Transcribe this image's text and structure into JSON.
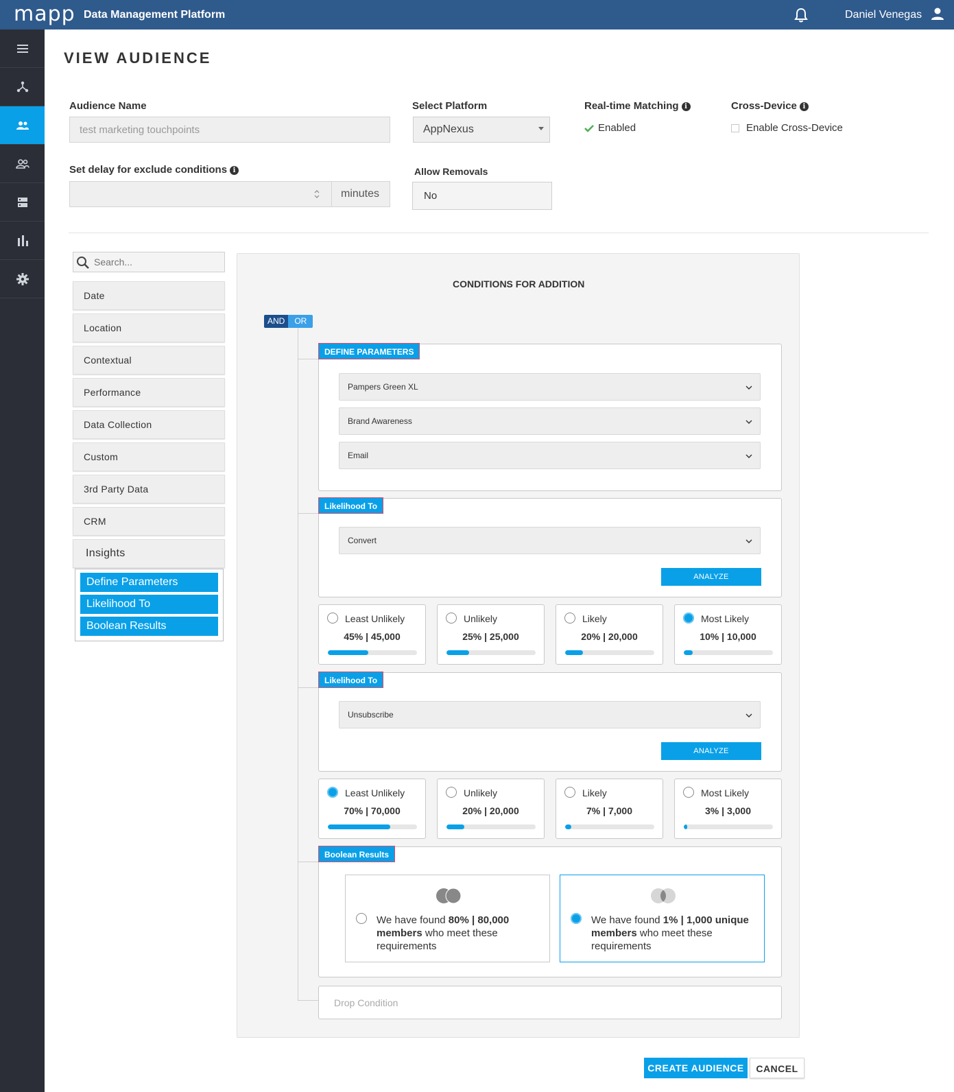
{
  "app": {
    "logo": "mapp",
    "title": "Data Management Platform",
    "user_name": "Daniel Venegas"
  },
  "colors": {
    "topbar": "#2f5a8c",
    "sidebar": "#2b2e36",
    "accent": "#0aa0e8"
  },
  "sidebar": {
    "items": [
      {
        "icon": "menu-icon"
      },
      {
        "icon": "network-icon"
      },
      {
        "icon": "audience-icon",
        "active": true
      },
      {
        "icon": "segments-icon"
      },
      {
        "icon": "data-icon"
      },
      {
        "icon": "chart-icon"
      },
      {
        "icon": "gear-icon"
      }
    ]
  },
  "page": {
    "title": "VIEW AUDIENCE"
  },
  "form": {
    "audience_name_label": "Audience Name",
    "audience_name_placeholder": "test marketing touchpoints",
    "platform_label": "Select Platform",
    "platform_value": "AppNexus",
    "realtime_label": "Real-time Matching",
    "realtime_value": "Enabled",
    "crossdevice_label": "Cross-Device",
    "crossdevice_value": "Enable Cross-Device",
    "delay_label": "Set delay for exclude conditions",
    "delay_unit": "minutes",
    "removals_label": "Allow Removals",
    "removals_value": "No"
  },
  "criteria": {
    "search_placeholder": "Search...",
    "categories": [
      "Date",
      "Location",
      "Contextual",
      "Performance",
      "Data Collection",
      "Custom",
      "3rd Party Data",
      "CRM",
      "Insights"
    ],
    "insights_items": [
      "Define Parameters",
      "Likelihood To",
      "Boolean Results"
    ]
  },
  "conditions": {
    "title": "CONDITIONS FOR ADDITION",
    "and_label": "AND",
    "or_label": "OR",
    "define": {
      "tag": "DEFINE PARAMETERS",
      "fields": [
        "Pampers Green XL",
        "Brand Awareness",
        "Email"
      ]
    },
    "likelihood_1": {
      "tag": "Likelihood To",
      "field": "Convert",
      "analyze": "ANALYZE",
      "options": [
        {
          "label": "Least Unlikely",
          "value": "45% | 45,000",
          "fraction": 0.45,
          "selected": false
        },
        {
          "label": "Unlikely",
          "value": "25% | 25,000",
          "fraction": 0.25,
          "selected": false
        },
        {
          "label": "Likely",
          "value": "20% | 20,000",
          "fraction": 0.2,
          "selected": false
        },
        {
          "label": "Most Likely",
          "value": "10% | 10,000",
          "fraction": 0.1,
          "selected": true
        }
      ]
    },
    "likelihood_2": {
      "tag": "Likelihood To",
      "field": "Unsubscribe",
      "analyze": "ANALYZE",
      "options": [
        {
          "label": "Least Unlikely",
          "value": "70% | 70,000",
          "fraction": 0.7,
          "selected": true
        },
        {
          "label": "Unlikely",
          "value": "20% | 20,000",
          "fraction": 0.2,
          "selected": false
        },
        {
          "label": "Likely",
          "value": "7% | 7,000",
          "fraction": 0.07,
          "selected": false
        },
        {
          "label": "Most Likely",
          "value": "3% | 3,000",
          "fraction": 0.03,
          "selected": false
        }
      ]
    },
    "boolean": {
      "tag": "Boolean Results",
      "result_a": {
        "pre": "We have found ",
        "bold1": "80% | 80,000",
        "mid": " ",
        "bold2": "members",
        "post": " who meet these requirements",
        "selected": false
      },
      "result_b": {
        "pre": "We have found ",
        "bold1": "1% | 1,000 unique",
        "mid": " ",
        "bold2": "members",
        "post": " who meet these requirements",
        "selected": true
      }
    },
    "drop_placeholder": "Drop Condition"
  },
  "actions": {
    "create": "CREATE AUDIENCE",
    "cancel": "CANCEL"
  }
}
